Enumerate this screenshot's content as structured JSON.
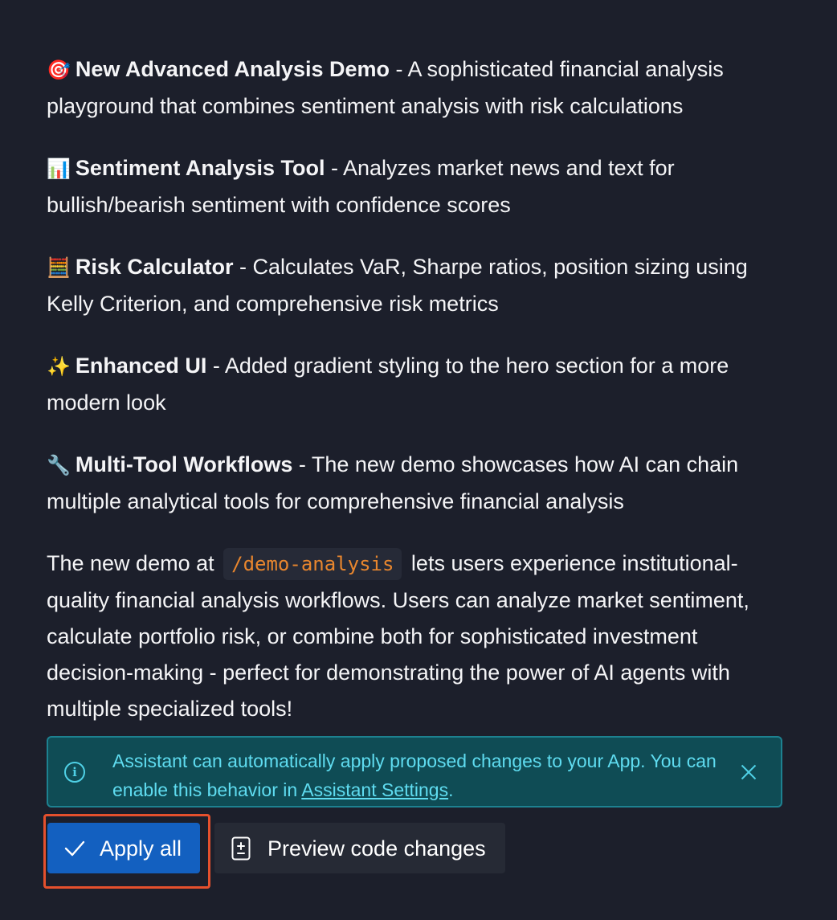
{
  "items": [
    {
      "icon": "direct-hit-emoji",
      "emoji": "🎯",
      "title": "New Advanced Analysis Demo",
      "text": " - A sophisticated financial analysis playground that combines sentiment analysis with risk calculations"
    },
    {
      "icon": "bar-chart-emoji",
      "emoji": "📊",
      "title": "Sentiment Analysis Tool",
      "text": " - Analyzes market news and text for bullish/bearish sentiment with confidence scores"
    },
    {
      "icon": "abacus-emoji",
      "emoji": "🧮",
      "title": "Risk Calculator",
      "text": " - Calculates VaR, Sharpe ratios, position sizing using Kelly Criterion, and comprehensive risk metrics"
    },
    {
      "icon": "sparkles-emoji",
      "emoji": "✨",
      "title": "Enhanced UI",
      "text": " - Added gradient styling to the hero section for a more modern look"
    },
    {
      "icon": "wrench-emoji",
      "emoji": "🔧",
      "title": "Multi-Tool Workflows",
      "text": " - The new demo showcases how AI can chain multiple analytical tools for comprehensive financial analysis"
    }
  ],
  "summary": {
    "before": "The new demo at ",
    "code": "/demo-analysis",
    "after": " lets users experience institutional-quality financial analysis workflows. Users can analyze market sentiment, calculate portfolio risk, or combine both for sophisticated investment decision-making - perfect for demonstrating the power of AI agents with multiple specialized tools!"
  },
  "banner": {
    "icon": "info-icon",
    "text_before": "Assistant can automatically apply proposed changes to your App. You can enable this behavior in ",
    "link": "Assistant Settings",
    "text_after": ".",
    "close_icon": "close-icon"
  },
  "actions": {
    "apply_all": "Apply all",
    "preview": "Preview code changes"
  },
  "colors": {
    "background": "#1c1f2b",
    "primary_button": "#1360c0",
    "banner_background": "#0f4c55",
    "banner_text": "#5fdcf0",
    "code_text": "#e8862e",
    "highlight": "#e5502d"
  }
}
